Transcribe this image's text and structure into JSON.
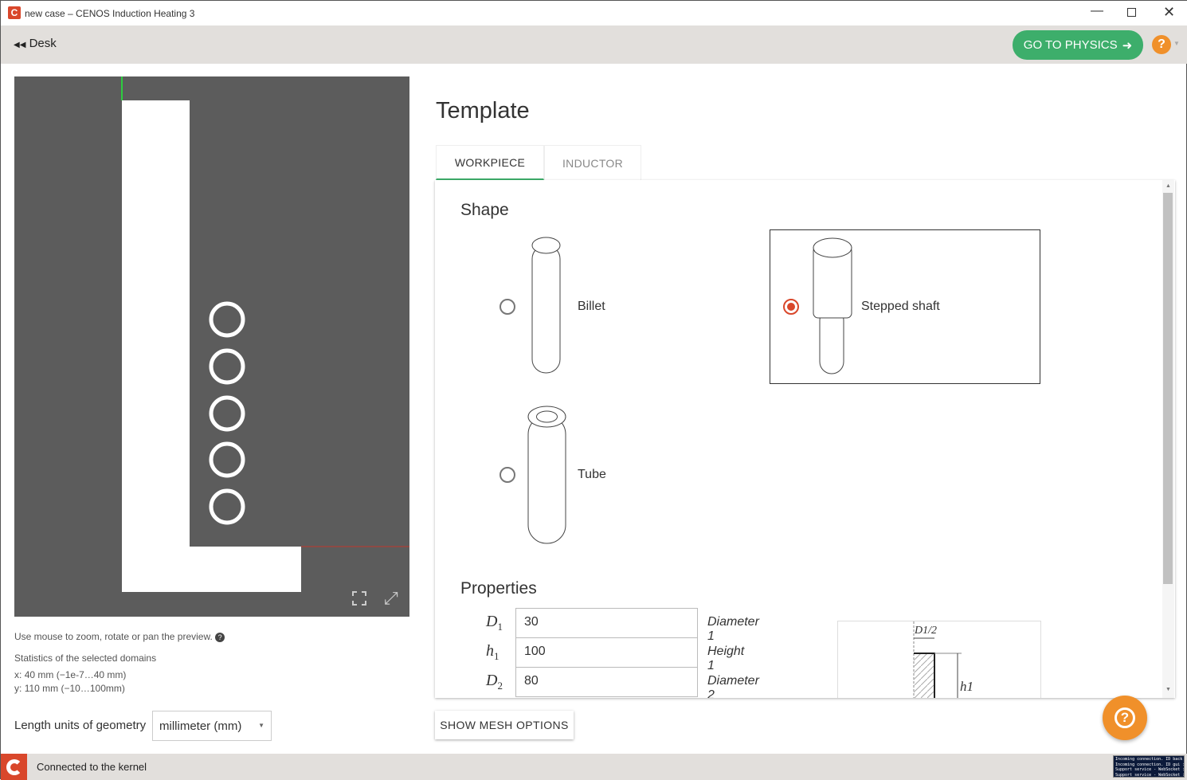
{
  "window": {
    "title": "new case – CENOS Induction Heating 3"
  },
  "header": {
    "back_label": "Desk",
    "go_physics": "GO TO PHYSICS",
    "help": "?"
  },
  "preview": {
    "hint": "Use mouse to zoom, rotate or pan the preview.",
    "stats_title": "Statistics of the selected domains",
    "x_label": "x:",
    "x_value": "40 mm",
    "x_range": "(−1e-7…40 mm)",
    "y_label": "y:",
    "y_value": "110 mm",
    "y_range": "(−10…100mm)"
  },
  "units": {
    "label": "Length units of geometry",
    "value": "millimeter (mm)"
  },
  "template": {
    "title": "Template",
    "tabs": [
      {
        "label": "WORKPIECE",
        "active": true
      },
      {
        "label": "INDUCTOR",
        "active": false
      }
    ],
    "shape_title": "Shape",
    "shapes": [
      {
        "label": "Billet",
        "selected": false
      },
      {
        "label": "Stepped shaft",
        "selected": true
      },
      {
        "label": "Tube",
        "selected": false
      }
    ],
    "properties_title": "Properties",
    "properties": [
      {
        "symbol": "D",
        "sub": "1",
        "value": "30",
        "desc": "Diameter 1"
      },
      {
        "symbol": "h",
        "sub": "1",
        "value": "100",
        "desc": "Height 1"
      },
      {
        "symbol": "D",
        "sub": "2",
        "value": "80",
        "desc": "Diameter 2"
      }
    ],
    "diagram": {
      "d_label": "D1/2",
      "h_label": "h1"
    }
  },
  "mesh_button": "SHOW MESH OPTIONS",
  "status": {
    "text": "Connected to the kernel",
    "log": [
      "Incoming connection. ID back",
      "Incoming connection. ID gui :",
      "Support service - WebSocket :",
      "Support service - WebSocket :"
    ]
  },
  "colors": {
    "accent_green": "#3dae6b",
    "orange": "#f0902a",
    "brand_red": "#d9472b",
    "selected_radio": "#d9472b"
  }
}
